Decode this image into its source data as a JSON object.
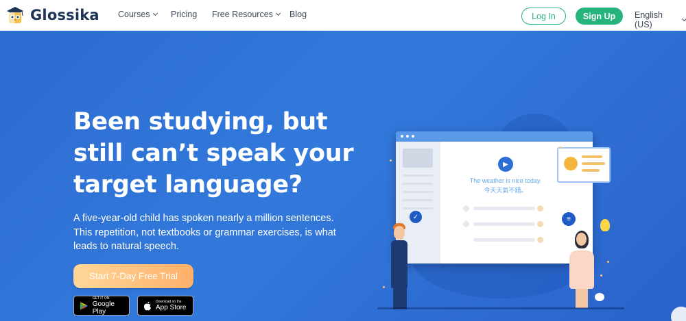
{
  "nav": {
    "brand": "Glossika",
    "links": [
      {
        "label": "Courses",
        "dropdown": true
      },
      {
        "label": "Pricing",
        "dropdown": false
      },
      {
        "label": "Free Resources",
        "dropdown": true
      },
      {
        "label": "Blog",
        "dropdown": false
      }
    ],
    "login_label": "Log In",
    "signup_label": "Sign Up",
    "language": "English (US)"
  },
  "hero": {
    "title": "Been studying, but still can’t speak your target language?",
    "subtitle": "A five-year-old child has spoken nearly a million sentences. This repetition, not textbooks or grammar exercises, is what leads to natural speech.",
    "cta_label": "Start 7-Day Free Trial",
    "stores": {
      "google_small": "GET IT ON",
      "google_big": "Google Play",
      "apple_small": "Download on the",
      "apple_big": "App Store"
    }
  },
  "illustration": {
    "phrase_en": "The weather is nice today.",
    "phrase_zh": "今天天氣不錯。"
  },
  "colors": {
    "brand_green": "#26b37c",
    "hero_blue": "#2f73d6",
    "cta_orange": "#ffb06a",
    "nav_text": "#3c4858"
  },
  "icons": [
    "logo-owl-icon",
    "chevron-down-icon",
    "google-play-icon",
    "apple-icon",
    "speaker-icon",
    "check-icon",
    "voice-icon"
  ]
}
